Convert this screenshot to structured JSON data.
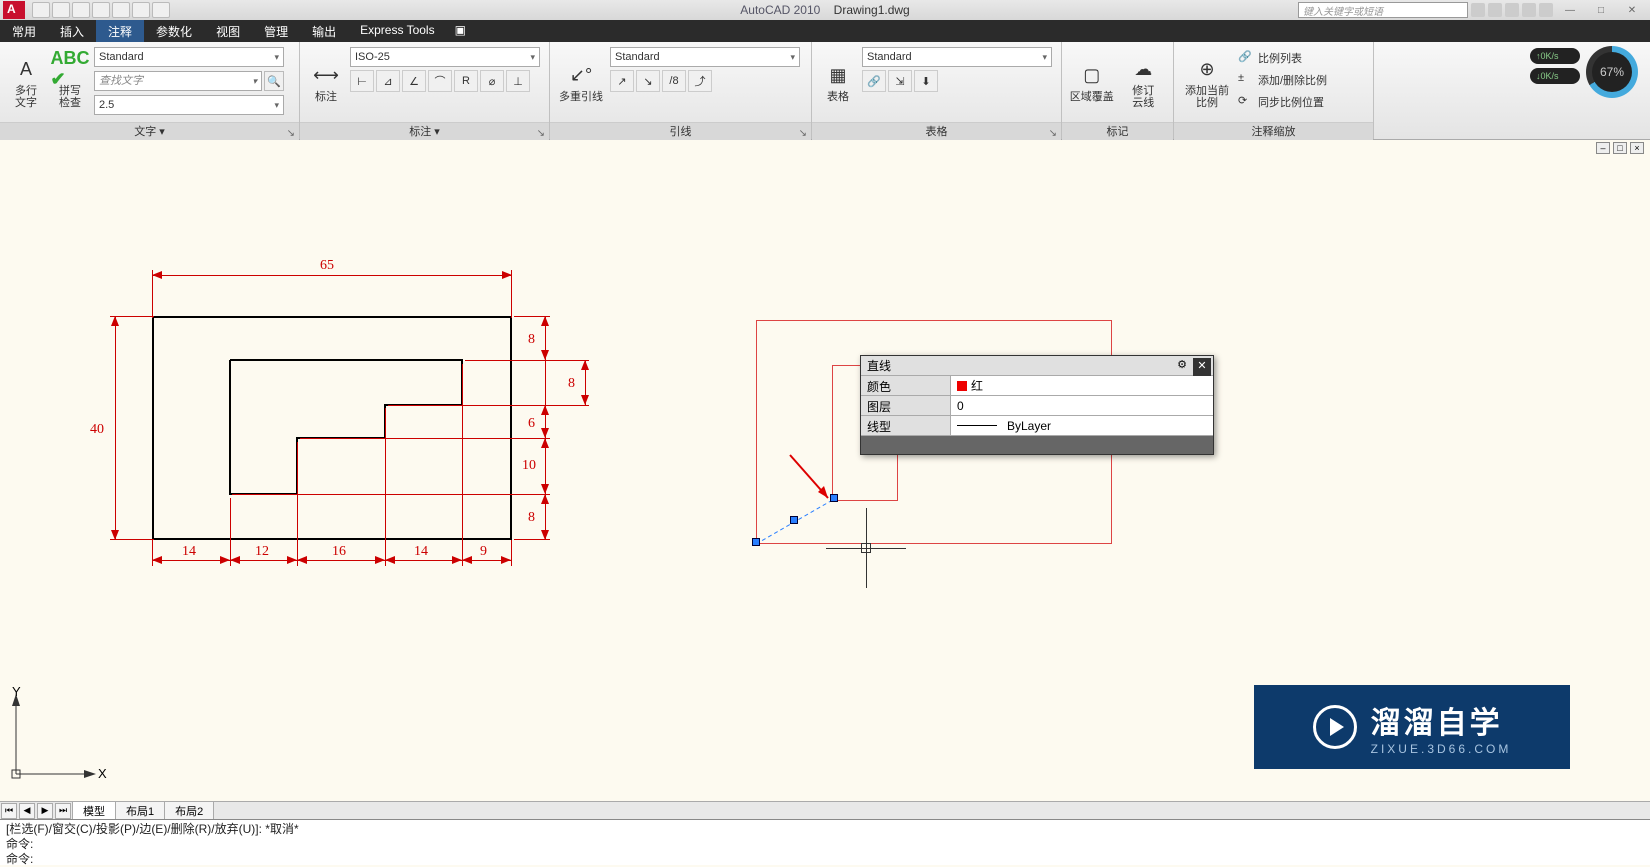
{
  "title": {
    "app": "AutoCAD 2010",
    "file": "Drawing1.dwg"
  },
  "search_placeholder": "键入关键字或短语",
  "tabs": {
    "t0": "常用",
    "t1": "插入",
    "t2": "注释",
    "t3": "参数化",
    "t4": "视图",
    "t5": "管理",
    "t6": "输出",
    "t7": "Express Tools"
  },
  "ribbon": {
    "text_panel": {
      "btn1": "多行\n文字",
      "btn2": "拼写\n检查",
      "style": "Standard",
      "find": "查找文字",
      "size": "2.5",
      "title": "文字"
    },
    "dim_panel": {
      "btn": "标注",
      "style": "ISO-25",
      "title": "标注"
    },
    "leader_panel": {
      "btn": "多重引线",
      "style": "Standard",
      "title": "引线"
    },
    "table_panel": {
      "btn": "表格",
      "style": "Standard",
      "title": "表格"
    },
    "markup_panel": {
      "btn1": "区域覆盖",
      "btn2": "修订\n云线",
      "title": "标记"
    },
    "scale_panel": {
      "btn": "添加当前比例",
      "s1": "比例列表",
      "s2": "添加/删除比例",
      "s3": "同步比例位置",
      "title": "注释缩放"
    }
  },
  "gauge_pct": "67%",
  "net1": "0K/s",
  "net2": "0K/s",
  "dims": {
    "w65": "65",
    "h40": "40",
    "b14a": "14",
    "b12": "12",
    "b16": "16",
    "b14b": "14",
    "b9": "9",
    "r8a": "8",
    "r8b": "8",
    "r6": "6",
    "r10": "10",
    "r8c": "8"
  },
  "props": {
    "header": "直线",
    "row1_label": "颜色",
    "row1_val": "红",
    "row2_label": "图层",
    "row2_val": "0",
    "row3_label": "线型",
    "row3_val": "ByLayer"
  },
  "bottom_tabs": {
    "t0": "模型",
    "t1": "布局1",
    "t2": "布局2"
  },
  "cmd": {
    "line1": "[栏选(F)/窗交(C)/投影(P)/边(E)/删除(R)/放弃(U)]:  *取消*",
    "line2": "命令:",
    "line3": "命令:"
  },
  "ucs": {
    "x": "X",
    "y": "Y"
  },
  "watermark": {
    "brand": "溜溜自学",
    "url": "ZIXUE.3D66.COM"
  }
}
